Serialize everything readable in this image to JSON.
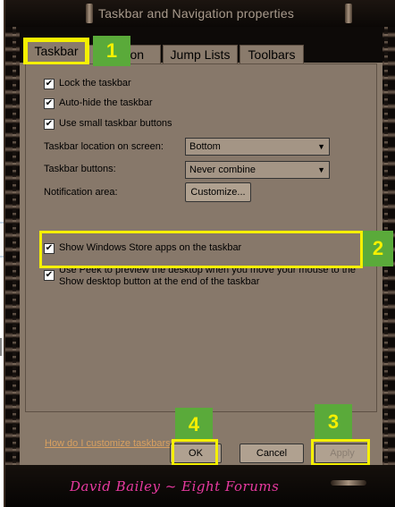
{
  "window": {
    "title": "Taskbar and Navigation properties"
  },
  "tabs": [
    {
      "label": "Taskbar",
      "active": true
    },
    {
      "label": "Navigation",
      "active": false
    },
    {
      "label": "Jump Lists",
      "active": false
    },
    {
      "label": "Toolbars",
      "active": false
    }
  ],
  "tab_navigation_visible": "N    ation",
  "options": {
    "lock": {
      "label": "Lock the taskbar",
      "checked": true
    },
    "autohide": {
      "label": "Auto-hide the taskbar",
      "checked": true
    },
    "small_buttons": {
      "label": "Use small taskbar buttons",
      "checked": true
    },
    "location": {
      "label": "Taskbar location on screen:",
      "value": "Bottom"
    },
    "buttons": {
      "label": "Taskbar buttons:",
      "value": "Never combine"
    },
    "notification": {
      "label": "Notification area:",
      "button": "Customize..."
    },
    "store_apps": {
      "label": "Show Windows Store apps on the taskbar",
      "checked": true
    },
    "peek": {
      "line1": "Use Peek to preview the desktop when you move your mouse to the",
      "line2": "Show desktop button at the end of the taskbar",
      "checked": true
    }
  },
  "help_link": "How do I customize taskbars?",
  "buttons": {
    "ok": "OK",
    "cancel": "Cancel",
    "apply": "Apply"
  },
  "annotations": {
    "badge1": "1",
    "badge2": "2",
    "badge3": "3",
    "badge4": "4",
    "highlight_color": "#f5f000",
    "badge_color": "#5aaa3a"
  },
  "signature": "David Bailey ~ Eight Forums",
  "colors": {
    "frame": "#1a1410",
    "dialog_bg": "#87786a",
    "link": "#d8a060",
    "signature": "#e83aa0"
  }
}
